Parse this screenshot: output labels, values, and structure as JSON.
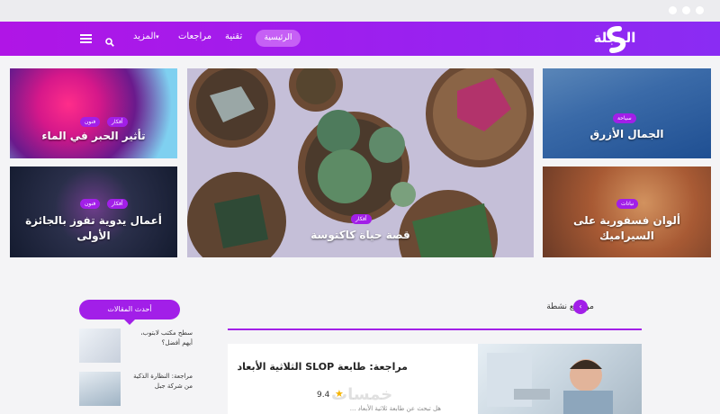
{
  "site": {
    "logo_text": "المجلة"
  },
  "nav": {
    "items": [
      "الرئيسية",
      "تقنية",
      "مراجعات",
      "المزيد"
    ],
    "active_index": 0
  },
  "featured": [
    {
      "title": "تأثير الحبر في الماء",
      "tags": [
        "فنون",
        "أفكار"
      ]
    },
    {
      "title": "أعمال يدوية تفوز بالجائزة الأولى",
      "tags": [
        "فنون",
        "أفكار"
      ]
    },
    {
      "title": "قصة حياة كاكتوسة",
      "tags": [
        "أفكار"
      ]
    },
    {
      "title": "الجمال الأزرق",
      "tags": [
        "سياحة"
      ]
    },
    {
      "title": "ألوان فسفورية على السيراميك",
      "tags": [
        "نباتات"
      ]
    }
  ],
  "sidebar": {
    "header": "أحدث المقالات",
    "items": [
      {
        "title": "سطح مكتب لابتوب، أيهم أفضل؟"
      },
      {
        "title": "مراجعة: النظارة الذكية من شركة جبل"
      }
    ]
  },
  "section": {
    "title": "مواضيع نشطة",
    "card": {
      "title": "مراجعة: طابعة SLOP الثلاثية الأبعاد",
      "rating": "9.4",
      "excerpt": "هل تبحث عن طابعة ثلاثية الأبعاد ..."
    }
  },
  "colors": {
    "accent": "#a21fe8",
    "nav_start": "#b015e6",
    "nav_end": "#8a2cf3"
  }
}
